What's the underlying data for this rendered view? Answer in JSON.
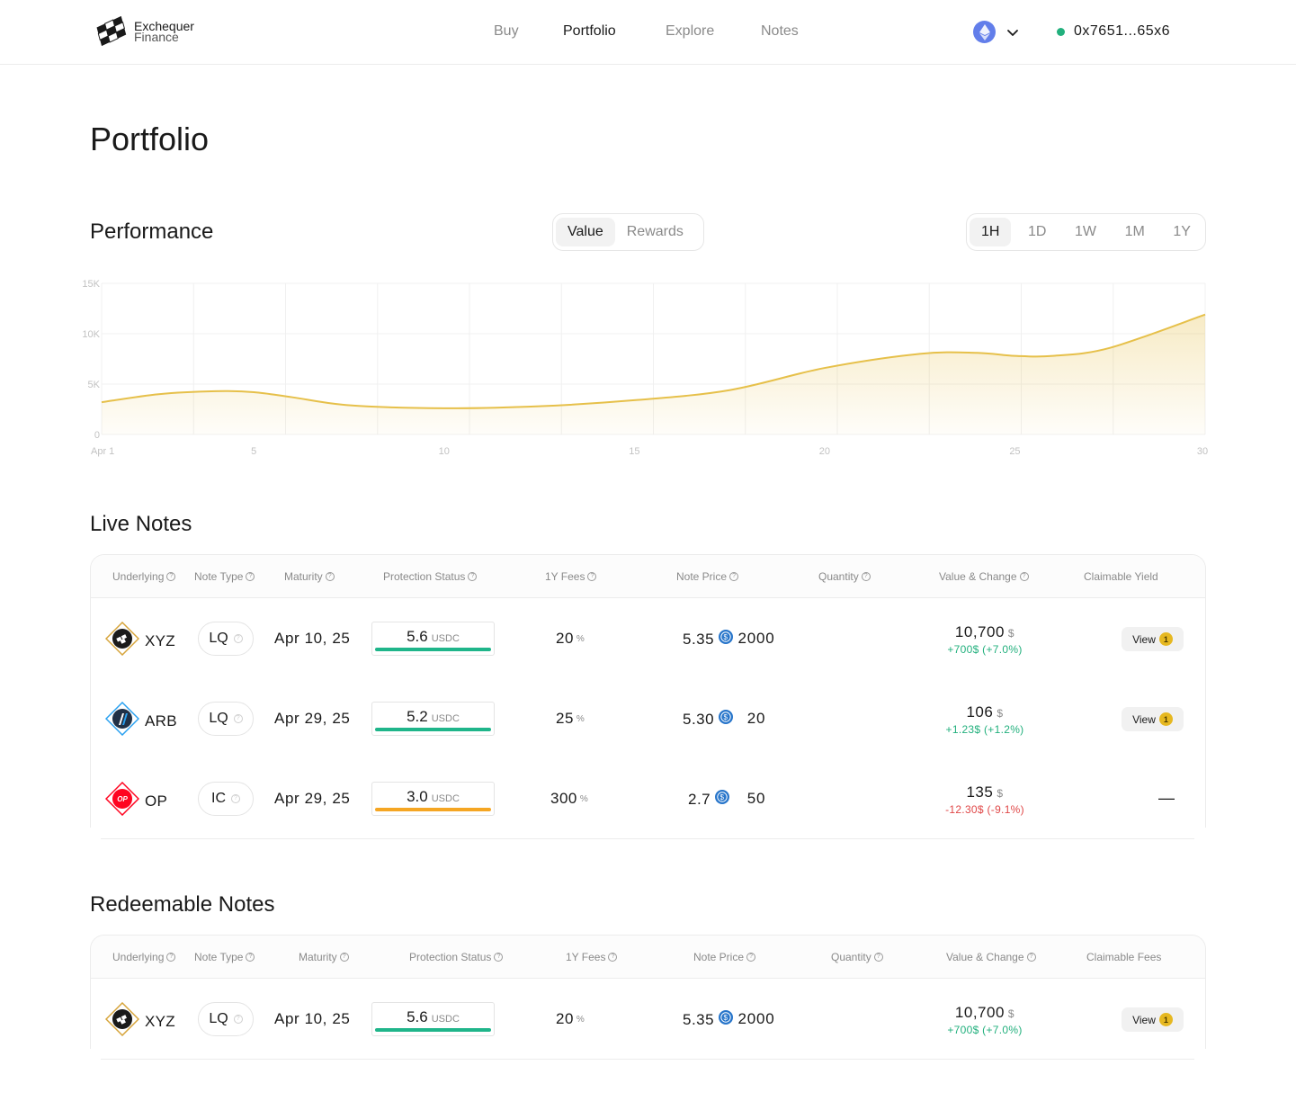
{
  "brand": {
    "line1": "Exchequer",
    "line2": "Finance"
  },
  "nav": [
    {
      "label": "Buy",
      "active": false
    },
    {
      "label": "Portfolio",
      "active": true
    },
    {
      "label": "Explore",
      "active": false
    },
    {
      "label": "Notes",
      "active": false
    }
  ],
  "chain": {
    "icon": "ethereum-icon"
  },
  "wallet": {
    "address": "0x7651...65x6",
    "status_color": "#22b07d"
  },
  "page_title": "Portfolio",
  "performance": {
    "title": "Performance",
    "metric_tabs": [
      {
        "label": "Value",
        "active": true
      },
      {
        "label": "Rewards",
        "active": false
      }
    ],
    "range_tabs": [
      {
        "label": "1H",
        "active": true
      },
      {
        "label": "1D",
        "active": false
      },
      {
        "label": "1W",
        "active": false
      },
      {
        "label": "1M",
        "active": false
      },
      {
        "label": "1Y",
        "active": false
      }
    ]
  },
  "chart_data": {
    "type": "area",
    "title": "",
    "xlabel": "",
    "ylabel": "",
    "x_tick_labels": [
      "Apr 1",
      "5",
      "10",
      "15",
      "20",
      "25",
      "30"
    ],
    "x_ticks": [
      1,
      5,
      10,
      15,
      20,
      25,
      30
    ],
    "y_tick_labels": [
      "0",
      "5K",
      "10K",
      "15K"
    ],
    "ylim": [
      0,
      15000
    ],
    "xlim": [
      1,
      30
    ],
    "grid": true,
    "color": "#e6c04a",
    "series": [
      {
        "x": [
          1,
          2.5,
          4,
          5,
          6,
          7.5,
          10,
          12.5,
          15,
          17.5,
          20,
          22.5,
          24,
          25,
          26,
          27.5,
          30
        ],
        "values": [
          3200,
          4000,
          4300,
          4200,
          3700,
          2900,
          2600,
          2800,
          3400,
          4400,
          6600,
          8000,
          8100,
          7800,
          7800,
          8600,
          11900
        ]
      }
    ]
  },
  "live_notes": {
    "title": "Live Notes",
    "headers": [
      "Underlying",
      "Note Type",
      "Maturity",
      "Protection Status",
      "1Y Fees",
      "Note Price",
      "Quantity",
      "Value & Change",
      "Claimable Yield"
    ],
    "rows": [
      {
        "symbol": "XYZ",
        "icon": "xyz-token-icon",
        "note_type": "LQ",
        "maturity": "Apr 10, 25",
        "protection": "5.6",
        "protection_unit": "USDC",
        "protection_color": "#1fb58a",
        "fees": "20",
        "fees_unit": "%",
        "price": "5.35",
        "quantity": "2000",
        "value": "10,700",
        "value_unit": "$",
        "change": "+700$ (+7.0%)",
        "change_dir": "up",
        "yield_label": "View",
        "yield_badge": "1"
      },
      {
        "symbol": "ARB",
        "icon": "arb-token-icon",
        "note_type": "LQ",
        "maturity": "Apr 29, 25",
        "protection": "5.2",
        "protection_unit": "USDC",
        "protection_color": "#1fb58a",
        "fees": "25",
        "fees_unit": "%",
        "price": "5.30",
        "quantity": "20",
        "value": "106",
        "value_unit": "$",
        "change": "+1.23$ (+1.2%)",
        "change_dir": "up",
        "yield_label": "View",
        "yield_badge": "1"
      },
      {
        "symbol": "OP",
        "icon": "op-token-icon",
        "note_type": "IC",
        "maturity": "Apr 29, 25",
        "protection": "3.0",
        "protection_unit": "USDC",
        "protection_color": "#f5a623",
        "fees": "300",
        "fees_unit": "%",
        "price": "2.7",
        "quantity": "50",
        "value": "135",
        "value_unit": "$",
        "change": "-12.30$ (-9.1%)",
        "change_dir": "down",
        "yield_label": "—",
        "yield_badge": ""
      }
    ]
  },
  "redeemable_notes": {
    "title": "Redeemable Notes",
    "headers": [
      "Underlying",
      "Note Type",
      "Maturity",
      "Protection Status",
      "1Y Fees",
      "Note Price",
      "Quantity",
      "Value & Change",
      "Claimable Fees"
    ],
    "rows": [
      {
        "symbol": "XYZ",
        "icon": "xyz-token-icon",
        "note_type": "LQ",
        "maturity": "Apr 10, 25",
        "protection": "5.6",
        "protection_unit": "USDC",
        "protection_color": "#1fb58a",
        "fees": "20",
        "fees_unit": "%",
        "price": "5.35",
        "quantity": "2000",
        "value": "10,700",
        "value_unit": "$",
        "change": "+700$ (+7.0%)",
        "change_dir": "up",
        "yield_label": "View",
        "yield_badge": "1"
      }
    ]
  }
}
